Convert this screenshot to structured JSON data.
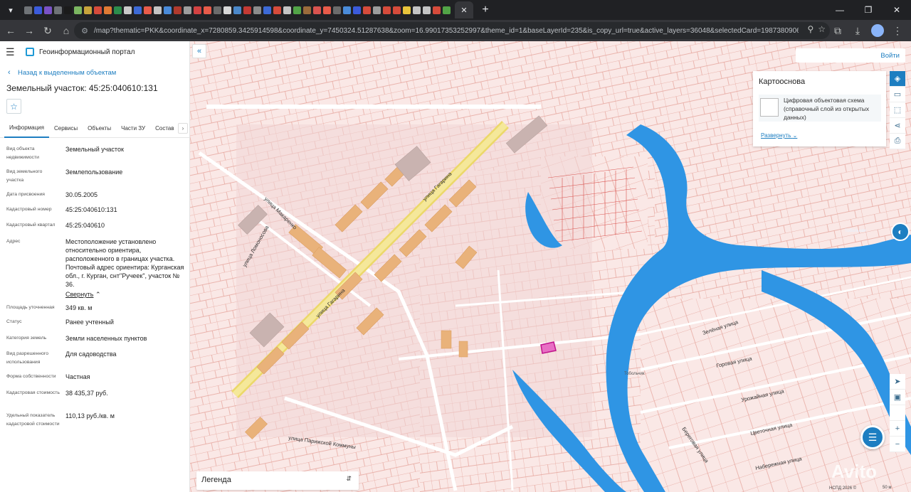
{
  "browser": {
    "omnibox_host": "",
    "url": "/map?thematic=PKK&coordinate_x=7280859.3425914598&coordinate_y=7450324.51287638&zoom=16.99017353252997&theme_id=1&baseLayerId=235&is_copy_url=true&active_layers=36048&selectedCard=1987380906%2..."
  },
  "header": {
    "portal_title": "Геоинформационный портал",
    "back_label": "Назад к выделенным объектам",
    "plot_title": "Земельный участок: 45:25:040610:131"
  },
  "tabs": [
    "Информация",
    "Сервисы",
    "Объекты",
    "Части ЗУ",
    "Состав"
  ],
  "info": {
    "rows": [
      {
        "key": "Вид объекта недвижимости",
        "value": "Земельный участок"
      },
      {
        "key": "Вид земельного участка",
        "value": "Землепользование"
      },
      {
        "key": "Дата присвоения",
        "value": "30.05.2005"
      },
      {
        "key": "Кадастровый номер",
        "value": "45:25:040610:131"
      },
      {
        "key": "Кадастровый квартал",
        "value": "45:25:040610"
      },
      {
        "key": "Адрес",
        "value": "Местоположение установлено относительно ориентира, расположенного в границах участка. Почтовый адрес ориентира: Курганская обл., г. Курган, снт\"Ручеек\", участок № 36."
      },
      {
        "key": "Площадь уточненная",
        "value": "349 кв. м"
      },
      {
        "key": "Статус",
        "value": "Ранее учтенный"
      },
      {
        "key": "Категория земель",
        "value": "Земли населенных пунктов"
      },
      {
        "key": "Вид разрешенного использования",
        "value": "Для садоводства"
      },
      {
        "key": "Форма собственности",
        "value": "Частная"
      },
      {
        "key": "Кадастровая стоимость",
        "value": "38 435,37 руб."
      },
      {
        "key": "Удельный показатель кадастровой стоимости",
        "value": "110,13 руб./кв. м"
      }
    ],
    "collapse_label": "Свернуть"
  },
  "map": {
    "login_label": "Войти",
    "layers_title": "Картооснова",
    "layer_name": "Цифровая объектовая схема (справочный слой из открытых данных)",
    "expand_label": "Развернуть",
    "legend_label": "Легенда",
    "footer_note": "НСПД 2026 ©",
    "scale_label": "50 м",
    "watermark": "Avito",
    "streets": [
      "улица Гагарина",
      "улица Гагарина",
      "улица Макаренко",
      "улица Ломоносова",
      "улица Парижской Коммуны",
      "Зелёная улица",
      "Горовая улица",
      "Урожайная улица",
      "Цветочная улица",
      "Береговая улица",
      "Набережная улица",
      "Тобольная",
      "Тобольчик"
    ],
    "colors": {
      "accent": "#1d7ec1",
      "water": "#2f95e4",
      "parcel": "#fae8e6",
      "parcel_line": "#e5a39a",
      "building": "#e9b27a",
      "selected": "#c0148c"
    }
  }
}
